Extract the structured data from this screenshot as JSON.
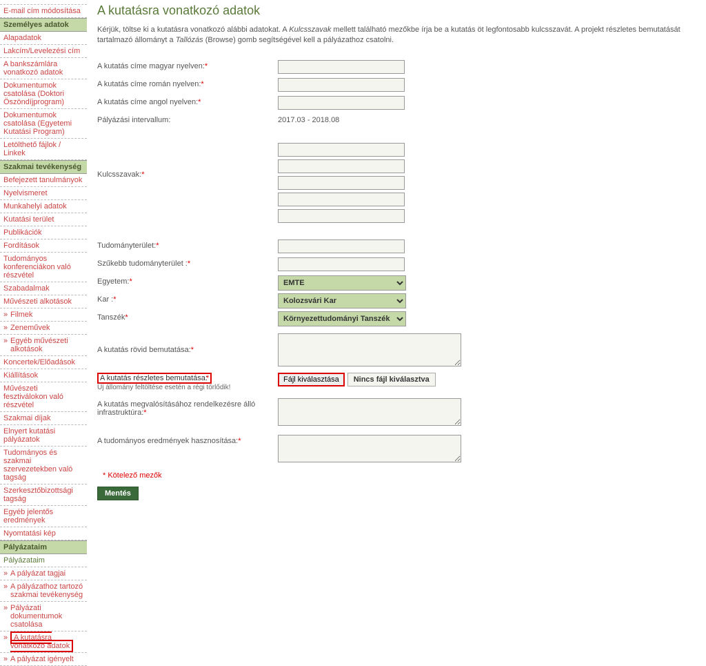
{
  "sidebar": {
    "top_items": [
      {
        "label": ""
      },
      {
        "label": "E-mail cím módosítása"
      }
    ],
    "sections": [
      {
        "title": "Személyes adatok",
        "items": [
          {
            "label": "Alapadatok"
          },
          {
            "label": "Lakcím/Levelezési cím"
          },
          {
            "label": "A bankszámlára vonatkozó adatok"
          },
          {
            "label": "Dokumentumok csatolása (Doktori Öszöndíjprogram)"
          },
          {
            "label": "Dokumentumok csatolása (Egyetemi Kutatási Program)"
          },
          {
            "label": "Letölthető fájlok / Linkek"
          }
        ]
      },
      {
        "title": "Szakmai tevékenység",
        "items": [
          {
            "label": "Befejezett tanulmányok"
          },
          {
            "label": "Nyelvismeret"
          },
          {
            "label": "Munkahelyi adatok"
          },
          {
            "label": "Kutatási terület"
          },
          {
            "label": "Publikációk"
          },
          {
            "label": "Fordítások"
          },
          {
            "label": "Tudományos konferenciákon való részvétel"
          },
          {
            "label": "Szabadalmak"
          },
          {
            "label": "Művészeti alkotások"
          },
          {
            "label": "Filmek",
            "sub": true
          },
          {
            "label": "Zeneművek",
            "sub": true
          },
          {
            "label": "Egyéb művészeti alkotások",
            "sub": true
          },
          {
            "label": "Koncertek/Előadások"
          },
          {
            "label": "Kiállítások"
          },
          {
            "label": "Művészeti fesztiválokon való részvétel"
          },
          {
            "label": "Szakmai díjak"
          },
          {
            "label": "Elnyert kutatási pályázatok"
          },
          {
            "label": "Tudományos és szakmai szervezetekben való tagság"
          },
          {
            "label": "Szerkesztőbizottsági tagság"
          },
          {
            "label": "Egyéb jelentős eredmények"
          },
          {
            "label": "Nyomtatási kép"
          }
        ]
      },
      {
        "title": "Pályázataim",
        "items": [
          {
            "label": "Pályázataim",
            "green": true
          },
          {
            "label": "A pályázat tagjai",
            "sub": true
          },
          {
            "label": "A pályázathoz tartozó szakmai tevékenység",
            "sub": true
          },
          {
            "label": "Pályázati dokumentumok csatolása",
            "sub": true
          },
          {
            "label": "A kutatásra vonatkozó adatok",
            "sub": true,
            "highlight": true
          },
          {
            "label": "A pályázat igényelt",
            "sub": true
          }
        ]
      }
    ]
  },
  "main": {
    "title": "A kutatásra vonatkozó adatok",
    "intro_p1": "Kérjük, töltse ki a kutatásra vonatkozó alábbi adatokat. A ",
    "intro_i1": "Kulcsszavak",
    "intro_p2": " mellett található mezőkbe írja be a kutatás öt legfontosabb kulcsszavát. A projekt részletes bemutatását tartalmazó állományt a ",
    "intro_i2": "Tallózás",
    "intro_p3": " (Browse) gomb segítségével kell a pályázathoz csatolni.",
    "labels": {
      "title_hu": "A kutatás címe magyar nyelven:",
      "title_ro": "A kutatás címe román nyelven:",
      "title_en": "A kutatás címe angol nyelven:",
      "interval": "Pályázási intervallum:",
      "interval_val": "2017.03 - 2018.08",
      "keywords": "Kulcsszavak:",
      "field": "Tudományterület:",
      "subfield": "Szűkebb tudományterület :",
      "university": "Egyetem:",
      "faculty": "Kar :",
      "department": "Tanszék",
      "short_desc": "A kutatás rövid bemutatása:",
      "detail_desc": "A kutatás részletes bemutatása:",
      "detail_note": "Új állomány feltöltése esetén a régi törlődik!",
      "file_btn": "Fájl kiválasztása",
      "file_status": "Nincs fájl kiválasztva",
      "infra": "A kutatás megvalósításához rendelkezésre álló infrastruktúra:",
      "results": "A tudományos eredmények hasznosítása:",
      "mandatory": "Kötelező mezők",
      "save": "Mentés"
    },
    "selects": {
      "university": "EMTE",
      "faculty": "Kolozsvári Kar",
      "department": "Környezettudományi Tanszék"
    }
  }
}
